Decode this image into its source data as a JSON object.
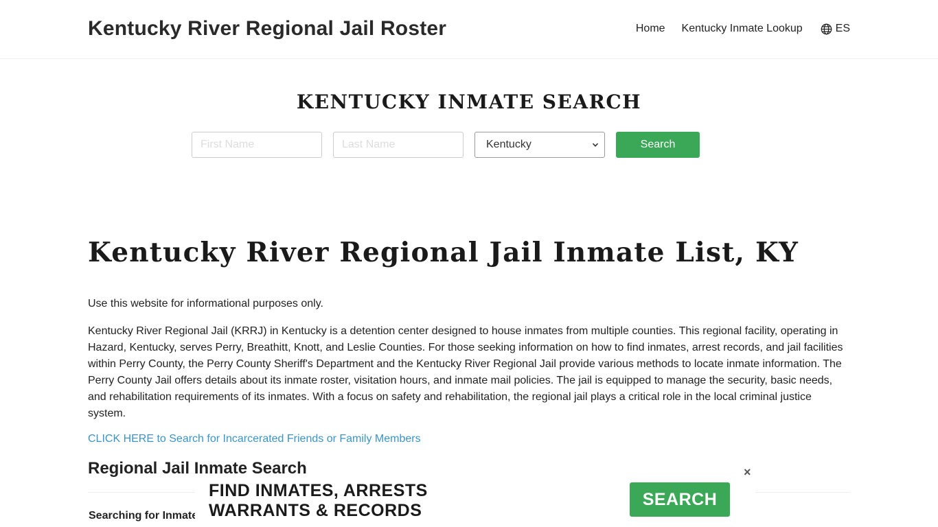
{
  "header": {
    "site_title": "Kentucky River Regional Jail Roster",
    "nav": {
      "home": "Home",
      "lookup": "Kentucky Inmate Lookup",
      "language": "ES",
      "language_icon": "globe-icon"
    }
  },
  "search": {
    "title": "KENTUCKY INMATE SEARCH",
    "first_name_placeholder": "First Name",
    "last_name_placeholder": "Last Name",
    "state_selected": "Kentucky",
    "button": "Search"
  },
  "main": {
    "title": "Kentucky River Regional Jail Inmate List, KY",
    "disclaimer": "Use this website for informational purposes only.",
    "description": "Kentucky River Regional Jail (KRRJ) in Kentucky is a detention center designed to house inmates from multiple counties. This regional facility, operating in Hazard, Kentucky, serves Perry, Breathitt, Knott, and Leslie Counties. For those seeking information on how to find inmates, arrest records, and jail facilities within Perry County, the Perry County Sheriff's Department and the Kentucky River Regional Jail provide various methods to locate inmate information. The Perry County Jail offers details about its inmate roster, visitation hours, and inmate mail policies. The jail is equipped to manage the security, basic needs, and rehabilitation requirements of its inmates. With a focus on safety and rehabilitation, the regional jail plays a critical role in the local criminal justice system.",
    "cta_link": "CLICK HERE to Search for Incarcerated Friends or Family Members",
    "section_title": "Regional Jail Inmate Search",
    "sub_label": "Searching for Inmate"
  },
  "ad": {
    "line1": "FIND INMATES, ARRESTS",
    "line2": "WARRANTS & RECORDS",
    "button": "SEARCH",
    "close": "×"
  },
  "colors": {
    "accent_green": "#3aa856",
    "link_blue": "#3b94c7"
  }
}
